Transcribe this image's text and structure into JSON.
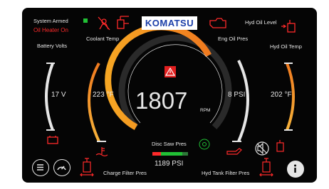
{
  "status": {
    "system_armed": "System Armed",
    "oil_heater": "Oil Heater On"
  },
  "brand": {
    "logo_text": "KOMATSU"
  },
  "top_right": {
    "hyd_oil_level": "Hyd Oil Level"
  },
  "gauges": {
    "battery": {
      "label": "Battery Volts",
      "value": "17 V"
    },
    "coolant": {
      "label": "Coolant Temp",
      "value": "223 °F"
    },
    "rpm": {
      "value": "1807",
      "unit": "RPM"
    },
    "eng_oil": {
      "label": "Eng Oil Pres",
      "value": "8 PSI"
    },
    "hyd_temp": {
      "label": "Hyd Oil Temp",
      "value": "202 °F"
    }
  },
  "disc_saw": {
    "label": "Disc Saw Pres",
    "value": "1189 PSI"
  },
  "bottom": {
    "charge_filter": "Charge Filter Pres",
    "hyd_tank_filter": "Hyd Tank Filter Pres"
  },
  "colors": {
    "amber": "#f6a623",
    "orange": "#f07a1f",
    "red": "#ff2a2a",
    "green": "#21c035",
    "white": "#e6e6e6"
  },
  "icons": [
    "no-seatbelt-icon",
    "hydraulic-tank-icon",
    "engine-check-icon",
    "hyd-oil-level-icon",
    "warning-triangle-icon",
    "battery-icon",
    "coolant-icon",
    "oil-can-icon",
    "gear-icon",
    "no-sound-icon",
    "filter-icon",
    "menu-icon",
    "gauge-icon",
    "info-icon"
  ]
}
